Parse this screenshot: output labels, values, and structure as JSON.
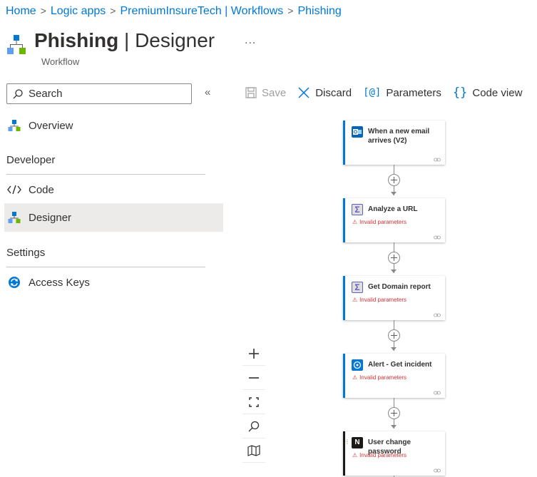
{
  "breadcrumb": {
    "items": [
      "Home",
      "Logic apps",
      "PremiumInsureTech | Workflows",
      "Phishing"
    ],
    "separator": ">"
  },
  "title": {
    "name": "Phishing",
    "divider": "|",
    "section": "Designer",
    "subtitle": "Workflow",
    "more": "..."
  },
  "sidebar": {
    "search_placeholder": "Search",
    "collapse_glyph": "«",
    "items": [
      {
        "label": "Overview",
        "icon": "hierarchy-icon"
      },
      {
        "label": "Code",
        "icon": "code-icon"
      },
      {
        "label": "Designer",
        "icon": "hierarchy-icon",
        "active": true
      },
      {
        "label": "Access Keys",
        "icon": "key-refresh-icon"
      }
    ],
    "sections": [
      "Developer",
      "Settings"
    ]
  },
  "toolbar": {
    "save": "Save",
    "discard": "Discard",
    "parameters": "Parameters",
    "code_view": "Code view"
  },
  "workflow": {
    "steps": [
      {
        "title": "When a new email arrives (V2)",
        "icon": "outlook-icon",
        "warning": ""
      },
      {
        "title": "Analyze a URL",
        "icon": "sigma-icon",
        "warning": "Invalid parameters"
      },
      {
        "title": "Get Domain report",
        "icon": "sigma-icon",
        "warning": "Invalid parameters"
      },
      {
        "title": "Alert - Get incident",
        "icon": "sentinel-icon",
        "warning": "Invalid parameters"
      },
      {
        "title": "User change password",
        "icon": "n-logo-icon",
        "warning": "Invalid parameters"
      }
    ]
  },
  "colors": {
    "accent": "#0078d4",
    "error": "#d13438",
    "text": "#323130"
  }
}
